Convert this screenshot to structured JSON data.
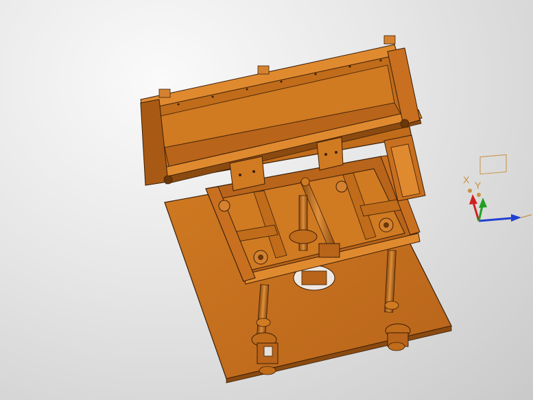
{
  "viewport": {
    "model_color": "#c8701a",
    "model_dark": "#8a4a10",
    "model_light": "#e08a30",
    "edge_color": "#3a1e08"
  },
  "triad": {
    "x_label": "X",
    "y_label": "Y",
    "x_color": "#d02020",
    "y_color": "#20a020",
    "z_color": "#2040d0",
    "arrow_tip_color": "#c89040"
  }
}
